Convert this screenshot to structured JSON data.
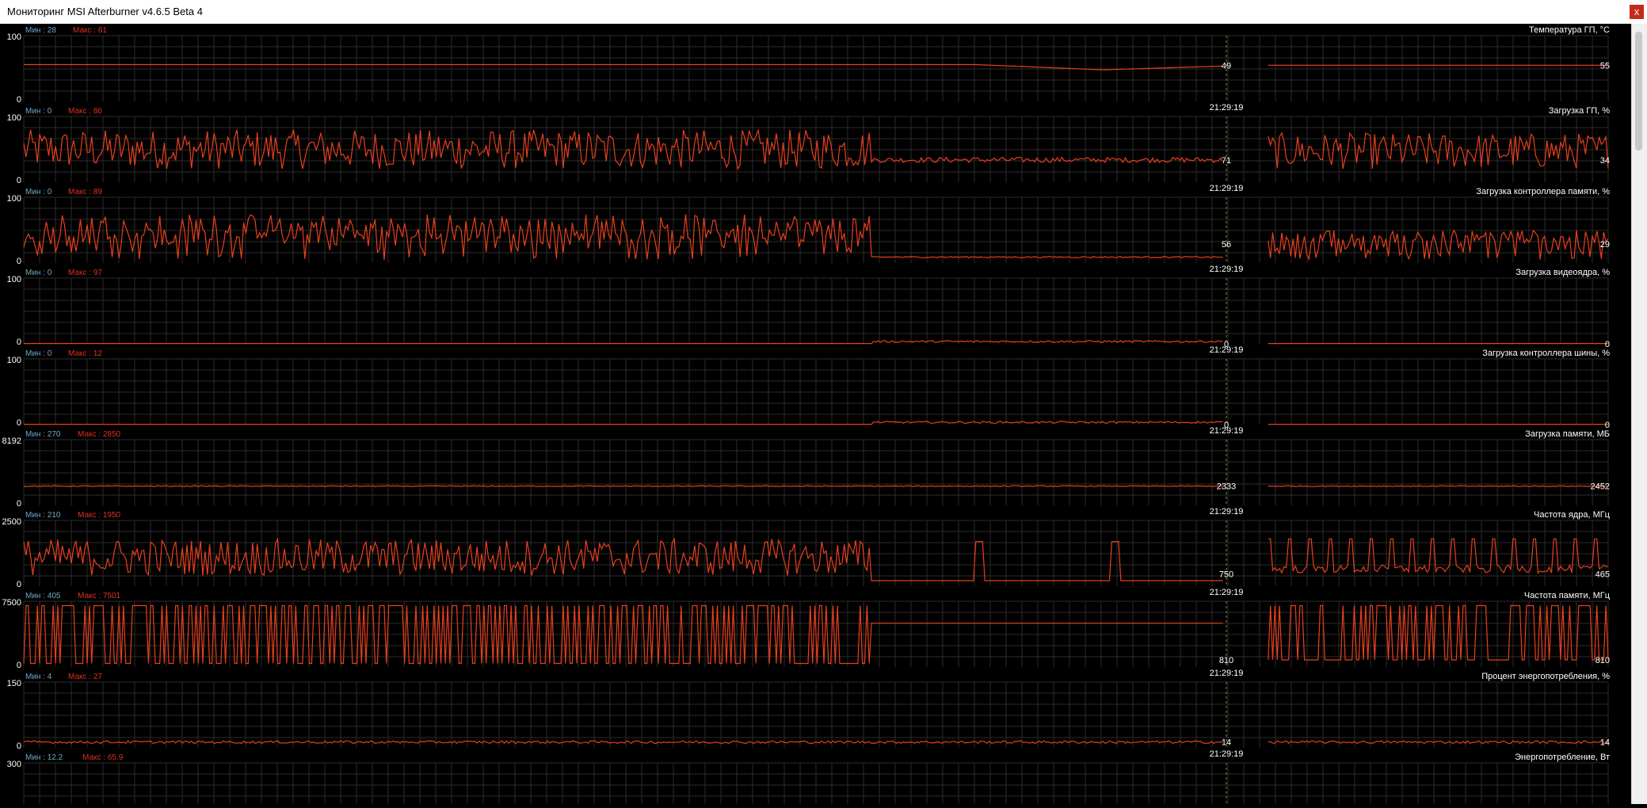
{
  "window": {
    "title": "Мониторинг MSI Afterburner v4.6.5 Beta 4",
    "close_label": "x"
  },
  "colors": {
    "background": "#000000",
    "grid": "#2b2b2b",
    "line": "#e8401c",
    "min_label": "#6fa8c7",
    "max_label": "#e0301e",
    "text": "#ffffff",
    "cursor": "#8a8a3a"
  },
  "cursor_time": "21:29:19",
  "graphs": [
    {
      "title": "Температура ГП, °C",
      "min_label": "Мин : 28",
      "max_label": "Макс : 61",
      "y_max": "100",
      "y_min": "0",
      "range": [
        0,
        100
      ],
      "cursor_value": "49",
      "current_value": "55",
      "time_label": "21:29:19",
      "pattern": "temp",
      "baseline": 55
    },
    {
      "title": "Загрузка ГП, %",
      "min_label": "Мин : 0",
      "max_label": "Макс : 86",
      "y_max": "100",
      "y_min": "0",
      "range": [
        0,
        100
      ],
      "cursor_value": "71",
      "current_value": "34",
      "time_label": "21:29:19",
      "pattern": "spiky",
      "baseline": 34
    },
    {
      "title": "Загрузка контроллера памяти, %",
      "min_label": "Мин : 0",
      "max_label": "Макс : 89",
      "y_max": "100",
      "y_min": "0",
      "range": [
        0,
        100
      ],
      "cursor_value": "56",
      "current_value": "29",
      "time_label": "21:29:19",
      "pattern": "square",
      "baseline": 29
    },
    {
      "title": "Загрузка видеоядра, %",
      "min_label": "Мин : 0",
      "max_label": "Макс : 97",
      "y_max": "100",
      "y_min": "0",
      "range": [
        0,
        100
      ],
      "cursor_value": "0",
      "current_value": "0",
      "time_label": "21:29:19",
      "pattern": "flat",
      "baseline": 0
    },
    {
      "title": "Загрузка контроллера шины, %",
      "min_label": "Мин : 0",
      "max_label": "Макс : 12",
      "y_max": "100",
      "y_min": "0",
      "range": [
        0,
        100
      ],
      "cursor_value": "0",
      "current_value": "0",
      "time_label": "21:29:19",
      "pattern": "flat",
      "baseline": 0
    },
    {
      "title": "Загрузка памяти, МБ",
      "min_label": "Мин : 270",
      "max_label": "Макс : 2850",
      "y_max": "8192",
      "y_min": "0",
      "range": [
        0,
        8192
      ],
      "cursor_value": "2333",
      "current_value": "2452",
      "time_label": "21:29:19",
      "pattern": "memflat",
      "baseline": 2400
    },
    {
      "title": "Частота ядра, МГц",
      "min_label": "Мин : 210",
      "max_label": "Макс : 1950",
      "y_max": "2500",
      "y_min": "0",
      "range": [
        0,
        2500
      ],
      "cursor_value": "750",
      "current_value": "465",
      "time_label": "21:29:19",
      "pattern": "coreclk",
      "baseline": 465
    },
    {
      "title": "Частота памяти, МГц",
      "min_label": "Мин : 405",
      "max_label": "Макс : 7501",
      "y_max": "7500",
      "y_min": "0",
      "range": [
        0,
        7500
      ],
      "cursor_value": "810",
      "current_value": "810",
      "time_label": "21:29:19",
      "pattern": "memclk",
      "baseline": 810
    },
    {
      "title": "Процент энергопотребления, %",
      "min_label": "Мин : 4",
      "max_label": "Макс : 27",
      "y_max": "150",
      "y_min": "0",
      "range": [
        0,
        150
      ],
      "cursor_value": "14",
      "current_value": "14",
      "time_label": "21:29:19",
      "pattern": "power",
      "baseline": 14
    },
    {
      "title": "Энергопотребление, Вт",
      "min_label": "Мин : 12.2",
      "max_label": "Макс : 65.9",
      "y_max": "300",
      "y_min": "",
      "range": [
        0,
        300
      ],
      "cursor_value": "",
      "current_value": "",
      "time_label": "",
      "pattern": "none",
      "baseline": 0
    }
  ]
}
